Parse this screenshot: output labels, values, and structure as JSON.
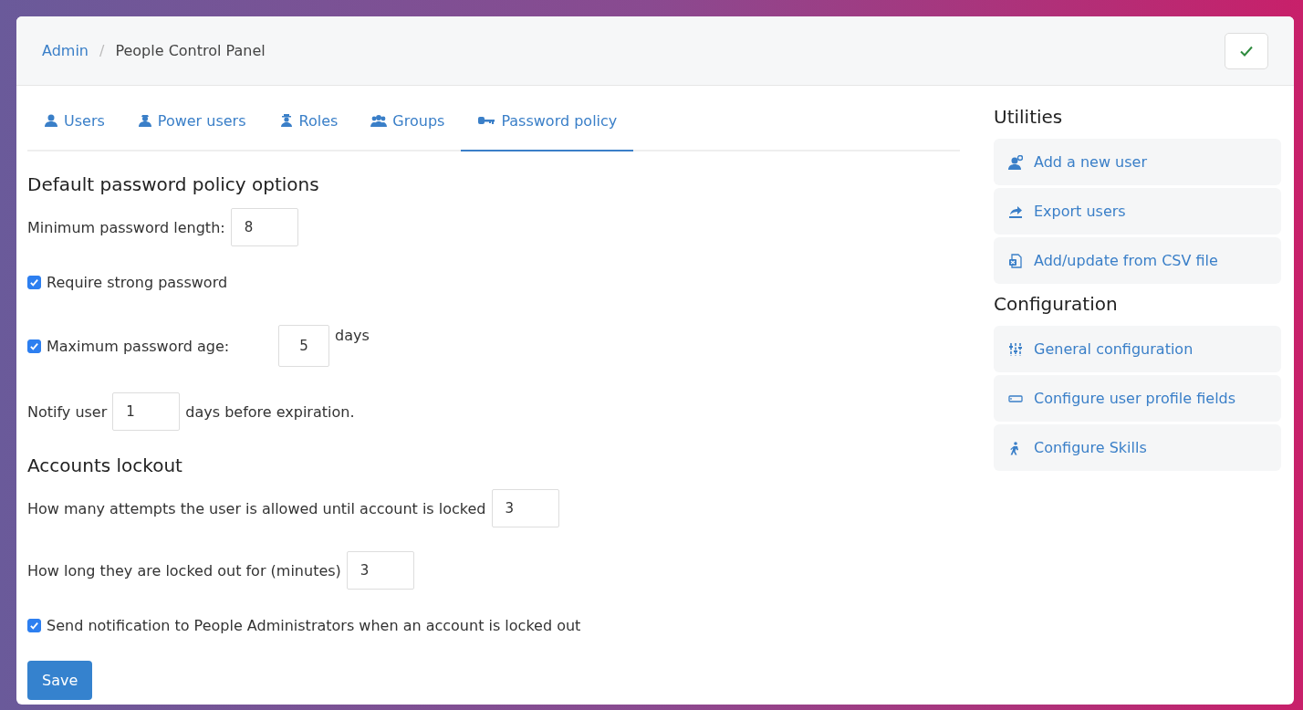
{
  "breadcrumb": {
    "parent": "Admin",
    "separator": "/",
    "current": "People Control Panel"
  },
  "tabs": [
    {
      "label": "Users",
      "selected": false
    },
    {
      "label": "Power users",
      "selected": false
    },
    {
      "label": "Roles",
      "selected": false
    },
    {
      "label": "Groups",
      "selected": false
    },
    {
      "label": "Password policy",
      "selected": true
    }
  ],
  "sections": [
    {
      "heading": "Default password policy options",
      "rows": [
        {
          "kind": "field",
          "label": "Minimum password length:",
          "value": "8"
        },
        {
          "kind": "check",
          "label": "Require strong password",
          "checked": true
        },
        {
          "kind": "check_field",
          "label": "Maximum password age:",
          "checked": true,
          "value": "5",
          "suffix": "days"
        },
        {
          "kind": "field",
          "label": "Notify user",
          "value": "1",
          "suffix": "days before expiration."
        }
      ]
    },
    {
      "heading": "Accounts lockout",
      "rows": [
        {
          "kind": "field",
          "label": "How many attempts the user is allowed until account is locked",
          "value": "3"
        },
        {
          "kind": "field",
          "label": "How long they are locked out for (minutes)",
          "value": "3"
        },
        {
          "kind": "check",
          "label": "Send notification to People Administrators when an account is locked out",
          "checked": true
        }
      ]
    }
  ],
  "save_button": "Save",
  "sidebar": [
    {
      "heading": "Utilities",
      "items": [
        "Add a new user",
        "Export users",
        "Add/update from CSV file"
      ]
    },
    {
      "heading": "Configuration",
      "items": [
        "General configuration",
        "Configure user profile fields",
        "Configure Skills"
      ]
    }
  ]
}
